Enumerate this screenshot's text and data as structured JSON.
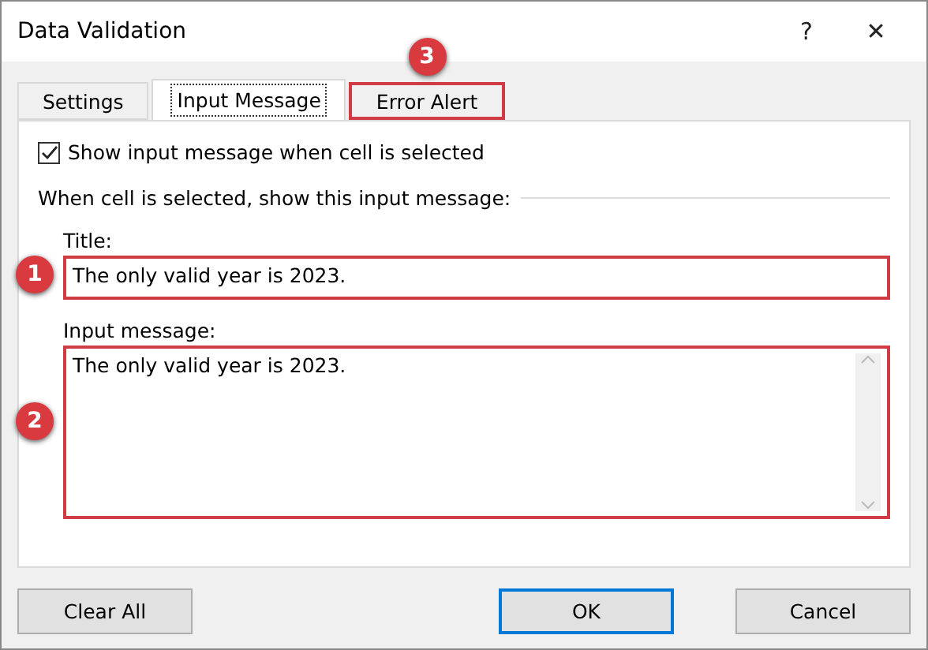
{
  "window": {
    "title": "Data Validation",
    "help": "?",
    "close": "✕"
  },
  "tabs": [
    {
      "label": "Settings",
      "selected": false,
      "highlighted": false
    },
    {
      "label": "Input Message",
      "selected": true,
      "highlighted": false
    },
    {
      "label": "Error Alert",
      "selected": false,
      "highlighted": true,
      "badge": "3"
    }
  ],
  "show_message": {
    "label": "Show input message when cell is selected",
    "checked": true
  },
  "group_label": "When cell is selected, show this input message:",
  "title_field": {
    "label": "Title:",
    "value": "The only valid year is 2023.",
    "highlighted": true,
    "badge": "1"
  },
  "message_field": {
    "label": "Input message:",
    "value": "The only valid year is 2023.",
    "highlighted": true,
    "badge": "2"
  },
  "buttons": [
    {
      "label": "Clear All",
      "default": false
    },
    {
      "label": "OK",
      "default": true
    },
    {
      "label": "Cancel",
      "default": false
    }
  ]
}
